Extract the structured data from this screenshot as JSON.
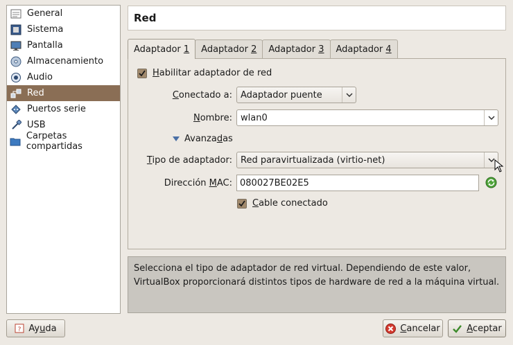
{
  "sidebar": {
    "items": [
      {
        "label": "General",
        "icon": "general-icon"
      },
      {
        "label": "Sistema",
        "icon": "system-icon"
      },
      {
        "label": "Pantalla",
        "icon": "display-icon"
      },
      {
        "label": "Almacenamiento",
        "icon": "storage-icon"
      },
      {
        "label": "Audio",
        "icon": "audio-icon"
      },
      {
        "label": "Red",
        "icon": "network-icon"
      },
      {
        "label": "Puertos serie",
        "icon": "serial-ports-icon"
      },
      {
        "label": "USB",
        "icon": "usb-icon"
      },
      {
        "label": "Carpetas compartidas",
        "icon": "shared-folders-icon"
      }
    ],
    "selected_index": 5
  },
  "page": {
    "title": "Red"
  },
  "tabs": [
    {
      "label": "Adaptador 1",
      "prefix": "Adaptador ",
      "mnemonic": "1"
    },
    {
      "label": "Adaptador 2",
      "prefix": "Adaptador ",
      "mnemonic": "2"
    },
    {
      "label": "Adaptador 3",
      "prefix": "Adaptador ",
      "mnemonic": "3"
    },
    {
      "label": "Adaptador 4",
      "prefix": "Adaptador ",
      "mnemonic": "4"
    }
  ],
  "form": {
    "enable": {
      "label_m": "H",
      "label_rest": "abilitar adaptador de red",
      "checked": true
    },
    "attached": {
      "label_m": "C",
      "label_rest": "onectado a:",
      "value": "Adaptador puente"
    },
    "name": {
      "label_m": "N",
      "label_rest": "ombre:",
      "value": "wlan0"
    },
    "advanced": {
      "label_pre": "Avanza",
      "label_m": "d",
      "label_post": "as"
    },
    "adapter_type": {
      "label_m": "T",
      "label_rest": "ipo de adaptador:",
      "value": "Red paravirtualizada (virtio-net)"
    },
    "mac": {
      "label_pre": "Dirección ",
      "label_m": "M",
      "label_post": "AC:",
      "value": "080027BE02E5"
    },
    "cable": {
      "label_m": "C",
      "label_rest": "able conectado",
      "checked": true
    }
  },
  "description": "Selecciona el tipo de adaptador de red virtual. Dependiendo de este valor, VirtualBox proporcionará distintos tipos de hardware de red a la máquina virtual.",
  "buttons": {
    "help": {
      "pre": "Ay",
      "m": "u",
      "post": "da"
    },
    "cancel": {
      "m": "C",
      "rest": "ancelar"
    },
    "accept": {
      "m": "A",
      "rest": "ceptar"
    }
  },
  "colors": {
    "selection": "#8a6e55",
    "accent": "#a28a6d"
  }
}
